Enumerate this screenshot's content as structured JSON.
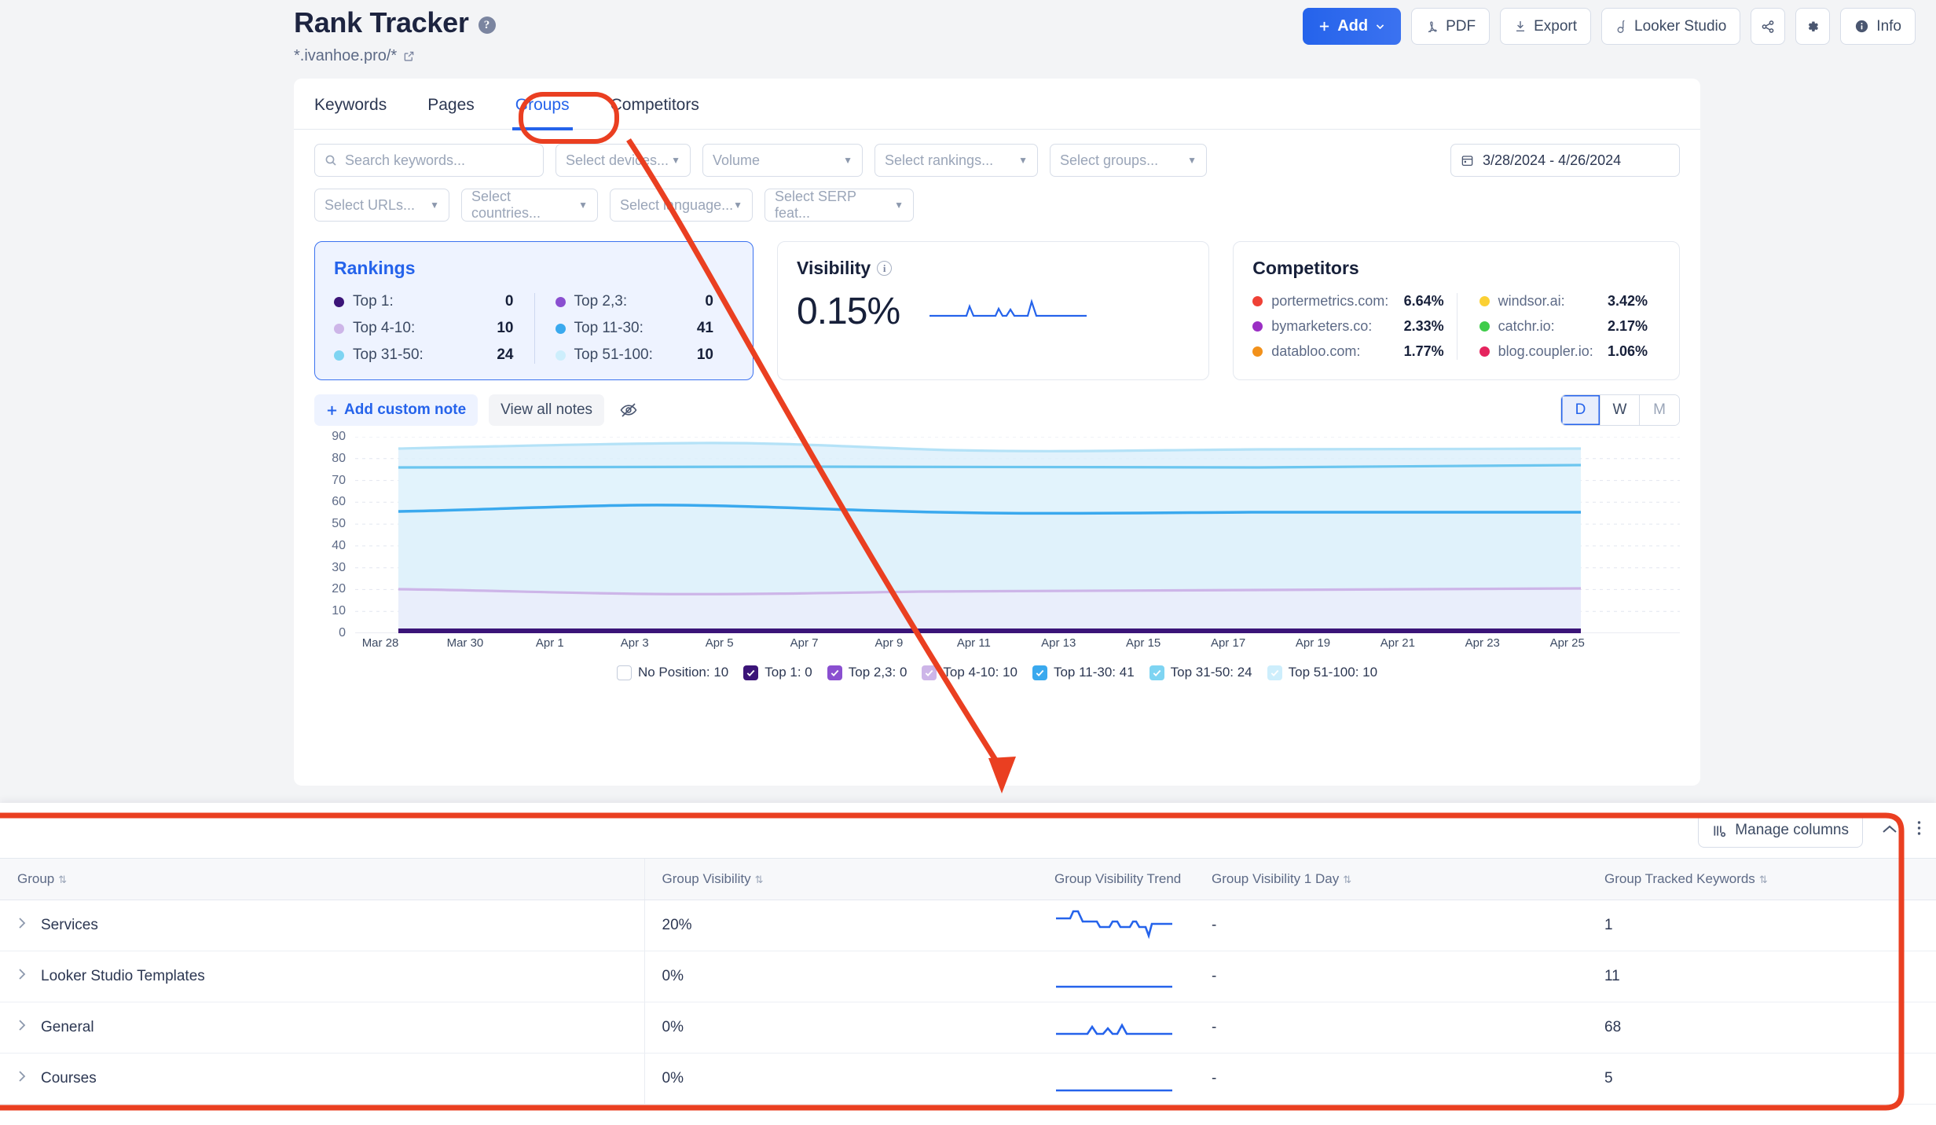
{
  "header": {
    "title": "Rank Tracker",
    "help_icon": "help-circle-icon",
    "domain": "*.ivanhoe.pro/*",
    "toolbar": {
      "add_label": "Add",
      "pdf_label": "PDF",
      "export_label": "Export",
      "looker_label": "Looker Studio",
      "info_label": "Info",
      "share_icon": "share-icon",
      "settings_icon": "gear-icon"
    }
  },
  "tabs": [
    {
      "label": "Keywords",
      "active": false
    },
    {
      "label": "Pages",
      "active": false
    },
    {
      "label": "Groups",
      "active": true
    },
    {
      "label": "Competitors",
      "active": false
    }
  ],
  "filters": {
    "search_placeholder": "Search keywords...",
    "devices": "Select devices...",
    "volume": "Volume",
    "rankings": "Select rankings...",
    "groups": "Select groups...",
    "date_range": "3/28/2024 - 4/26/2024",
    "urls": "Select URLs...",
    "countries": "Select countries...",
    "languages": "Select language...",
    "serp_features": "Select SERP feat..."
  },
  "rankings_card": {
    "title": "Rankings",
    "left": [
      {
        "label": "Top 1:",
        "value": "0",
        "color": "#3b1478"
      },
      {
        "label": "Top 4-10:",
        "value": "10",
        "color": "#cdb5e8"
      },
      {
        "label": "Top 31-50:",
        "value": "24",
        "color": "#7ed4f2"
      }
    ],
    "right": [
      {
        "label": "Top 2,3:",
        "value": "0",
        "color": "#8a4fd0"
      },
      {
        "label": "Top 11-30:",
        "value": "41",
        "color": "#3aa9ee"
      },
      {
        "label": "Top 51-100:",
        "value": "10",
        "color": "#cdeefc"
      }
    ]
  },
  "visibility_card": {
    "title": "Visibility",
    "info_icon": "info-circle-icon",
    "value": "0.15%"
  },
  "competitors_card": {
    "title": "Competitors",
    "left": [
      {
        "label": "portermetrics.com:",
        "value": "6.64%",
        "color": "#ef4136"
      },
      {
        "label": "bymarketers.co:",
        "value": "2.33%",
        "color": "#9b2fc4"
      },
      {
        "label": "databloo.com:",
        "value": "1.77%",
        "color": "#f2911b"
      }
    ],
    "right": [
      {
        "label": "windsor.ai:",
        "value": "3.42%",
        "color": "#fbd034"
      },
      {
        "label": "catchr.io:",
        "value": "2.17%",
        "color": "#3fcc4a"
      },
      {
        "label": "blog.coupler.io:",
        "value": "1.06%",
        "color": "#e5245e"
      }
    ]
  },
  "notes_bar": {
    "add_note": "Add custom note",
    "view_notes": "View all notes",
    "hide_icon": "eye-off-icon",
    "granularity": [
      {
        "label": "D",
        "selected": true
      },
      {
        "label": "W",
        "selected": false
      },
      {
        "label": "M",
        "selected": false
      }
    ]
  },
  "chart_data": {
    "type": "area",
    "title": "",
    "xlabel": "",
    "ylabel": "",
    "ylim": [
      0,
      90
    ],
    "grid": true,
    "legend_position": "bottom",
    "yticks": [
      0,
      10,
      20,
      30,
      40,
      50,
      60,
      70,
      80,
      90
    ],
    "xticks": [
      "Mar 28",
      "Mar 30",
      "Apr 1",
      "Apr 3",
      "Apr 5",
      "Apr 7",
      "Apr 9",
      "Apr 11",
      "Apr 13",
      "Apr 15",
      "Apr 17",
      "Apr 19",
      "Apr 21",
      "Apr 23",
      "Apr 25"
    ],
    "x": [
      "Mar 28",
      "Mar 29",
      "Mar 30",
      "Mar 31",
      "Apr 1",
      "Apr 2",
      "Apr 3",
      "Apr 4",
      "Apr 5",
      "Apr 6",
      "Apr 7",
      "Apr 8",
      "Apr 9",
      "Apr 10",
      "Apr 11",
      "Apr 12",
      "Apr 13",
      "Apr 14",
      "Apr 15",
      "Apr 16",
      "Apr 17",
      "Apr 18",
      "Apr 19",
      "Apr 20",
      "Apr 21",
      "Apr 22",
      "Apr 23",
      "Apr 24",
      "Apr 25",
      "Apr 26"
    ],
    "stacked": true,
    "series": [
      {
        "name": "Top 1",
        "color": "#3b1478",
        "values": [
          1,
          1,
          1,
          1,
          1,
          1,
          1,
          1,
          1,
          1,
          1,
          1,
          1,
          1,
          1,
          1,
          1,
          1,
          1,
          1,
          1,
          1,
          1,
          1,
          1,
          1,
          1,
          1,
          1,
          1
        ]
      },
      {
        "name": "Top 2,3",
        "color": "#8a4fd0",
        "values": [
          0,
          0,
          0,
          0,
          0,
          0,
          0,
          0,
          0,
          0,
          0,
          0,
          0,
          0,
          0,
          0,
          0,
          0,
          0,
          0,
          0,
          0,
          0,
          0,
          0,
          0,
          0,
          0,
          0,
          0
        ]
      },
      {
        "name": "Top 4-10",
        "color": "#cdb5e8",
        "values": [
          19,
          19,
          19,
          19,
          18,
          18,
          18,
          18,
          18,
          19,
          19,
          19,
          19,
          19,
          19,
          19,
          19,
          19,
          19,
          19,
          19,
          19,
          19,
          19,
          19,
          19,
          19,
          19,
          19,
          19
        ]
      },
      {
        "name": "Top 11-30",
        "color": "#3aa9ee",
        "values": [
          36,
          37,
          37,
          38,
          38,
          39,
          38,
          38,
          38,
          37,
          37,
          37,
          37,
          37,
          37,
          37,
          37,
          37,
          37,
          37,
          37,
          37,
          37,
          37,
          37,
          37,
          37,
          37,
          37,
          37
        ]
      },
      {
        "name": "Top 31-50",
        "color": "#7ed4f2",
        "values": [
          20,
          20,
          20,
          19,
          19,
          19,
          19,
          19,
          19,
          20,
          20,
          20,
          20,
          20,
          20,
          20,
          20,
          20,
          20,
          20,
          20,
          20,
          20,
          20,
          20,
          20,
          20,
          20,
          20,
          20
        ]
      },
      {
        "name": "Top 51-100",
        "color": "#cdeefc",
        "values": [
          9,
          9,
          9,
          9,
          10,
          10,
          10,
          10,
          10,
          9,
          9,
          9,
          9,
          9,
          9,
          9,
          9,
          9,
          9,
          9,
          9,
          9,
          9,
          9,
          9,
          9,
          9,
          9,
          9,
          9
        ]
      }
    ],
    "legend": [
      {
        "label": "No Position: 10",
        "checked": false,
        "color": "#ffffff"
      },
      {
        "label": "Top 1: 0",
        "checked": true,
        "color": "#3b1478"
      },
      {
        "label": "Top 2,3: 0",
        "checked": true,
        "color": "#8a4fd0"
      },
      {
        "label": "Top 4-10: 10",
        "checked": true,
        "color": "#cdb5e8"
      },
      {
        "label": "Top 11-30: 41",
        "checked": true,
        "color": "#3aa9ee"
      },
      {
        "label": "Top 31-50: 24",
        "checked": true,
        "color": "#7ed4f2"
      },
      {
        "label": "Top 51-100: 10",
        "checked": true,
        "color": "#cdeefc"
      }
    ]
  },
  "table_panel": {
    "manage_columns": "Manage columns",
    "collapse_icon": "chevron-up-icon",
    "kebab_icon": "more-vertical-icon",
    "columns": [
      {
        "label": "Group",
        "sortable": true
      },
      {
        "label": "Group Visibility",
        "sortable": true
      },
      {
        "label": "Group Visibility Trend",
        "sortable": false
      },
      {
        "label": "Group Visibility 1 Day",
        "sortable": true
      },
      {
        "label": "Group Tracked Keywords",
        "sortable": true
      }
    ],
    "rows": [
      {
        "group": "Services",
        "visibility": "20%",
        "one_day": "-",
        "keywords": "1",
        "trend": "volatile"
      },
      {
        "group": "Looker Studio Templates",
        "visibility": "0%",
        "one_day": "-",
        "keywords": "11",
        "trend": "flat"
      },
      {
        "group": "General",
        "visibility": "0%",
        "one_day": "-",
        "keywords": "68",
        "trend": "wavy"
      },
      {
        "group": "Courses",
        "visibility": "0%",
        "one_day": "-",
        "keywords": "5",
        "trend": "flat"
      }
    ]
  },
  "colors": {
    "accent": "#2563eb",
    "annotation": "#ea3f21",
    "page_bg": "#f3f4f6"
  }
}
